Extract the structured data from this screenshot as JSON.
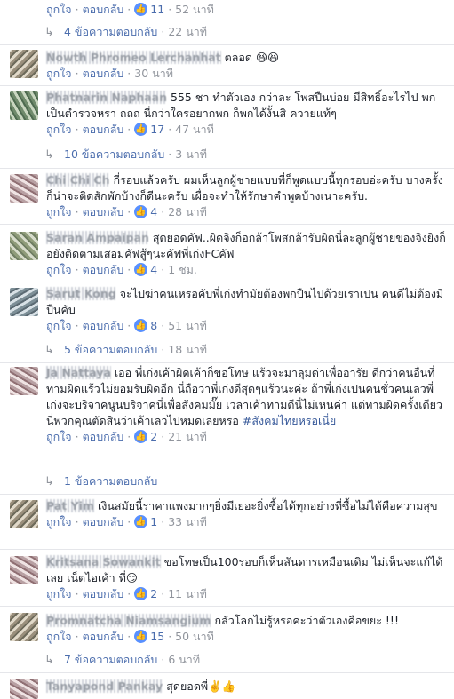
{
  "actions": {
    "like": "ถูกใจ",
    "reply": "ตอบกลับ",
    "sep": "·"
  },
  "comments": [
    {
      "name": "",
      "text": "",
      "likes": "11",
      "time": "52 นาที"
    },
    {
      "name": "Nowth Phromeo Lerchanhat",
      "text": "ตลอด 😆😆",
      "likes": "",
      "time": "30 นาที"
    },
    {
      "name": "Phatnarin Naphaan",
      "text": "555 ชา ทำตัวเอง กว่าละ โพสปืนบ่อย มีสิทธิ์อะไรไป พก เป็นตำรวจหรา ถถถ นี่กว่าใครอยากพก ก็พกได้งั้นสิ ควายแท้ๆ",
      "likes": "17",
      "time": "47 นาที"
    },
    {
      "name": "Chi Chi Ch",
      "text": "กี่รอบแล้วครับ ผมเห็นลูกผู้ชายแบบพี่ก็พูดแบบนี้ทุกรอบอ่ะครับ บางครั้งก็น่าจะติดสักพักบ้างก็ดีนะครับ เผื่อจะทำให้รักษาคำพูดบ้างเนาะครับ.",
      "likes": "4",
      "time": "28 นาที"
    },
    {
      "name": "Saran Ampaipan",
      "text": "สุดยอดคัฟ..ผิดจิงก็อกล้าโพสกล้ารับผิดนี่ละลูกผู้ชายของจิงยิงก็อยังติดตามเสอมคัฟสู้ๆนะคัฟพี่เก่งFCคัฟ",
      "likes": "4",
      "time": "1 ชม."
    },
    {
      "name": "Sarut Kong",
      "text": "จะไปฆ่าคนเหรอคับพี่เก่งทำมัยต้องพกปืนไปด้วยเราเปน คนดีไม่ต้องมีปืนคับ",
      "likes": "8",
      "time": "51 นาที"
    },
    {
      "name": "Ja Nattaya",
      "text": "เออ พี่เก่งเค้าผิดเค้าก็ขอโทษ แร้วจะมาลุมด่าเพื่ออารัย ดีกว่าคนอื่นที่ทามผิดแร้วไม่ยอมรับผิดอีก นี่ถือว่าพี่เก่งดีสุดๆแร้วนะค่ะ ถ้าพี่เก่งเปนคนชั่วคนเลวพี่เก่งจะบริจาคนูนบริจาคนี่เพื่อสังคมมั๊ย เวลาเค้าทามดีนี่ไม่เหนค่า แต่ทามผิดครั้งเดียวนี่พวกคุณตัดสินว่าเค้าเลวไปหมดเลยหรอ ",
      "hashtag": "#สังคมไทยหรอเนี่ย",
      "likes": "2",
      "time": "21 นาที"
    },
    {
      "name": "Pat Yim",
      "text": "เงินสมัยนี้ราคาแพงมากๆยิ่งมีเยอะยิ่งซื้อได้ทุกอย่างที่ซื้อไม่ได้คือความสุข",
      "likes": "1",
      "time": "33 นาที"
    },
    {
      "name": "Kritsana Sowankit",
      "text": "ขอโทษเป็น100รอบก็เห็นสันดารเหมือนเดิม ไม่เห็นจะแก้ได้เลย เน็ตไอเค้า ที่😏",
      "likes": "2",
      "time": "11 นาที"
    },
    {
      "name": "Promnatcha Niamsangium",
      "text": "กลัวโลกไม่รู้หรอคะว่าตัวเองคือขยะ !!!",
      "likes": "15",
      "time": "50 นาที"
    },
    {
      "name": "Tanyapond Pankay",
      "text": "สุดยอดพี่✌️👍",
      "likes": "",
      "time": ""
    }
  ],
  "reply_threads": [
    {
      "label": "4 ข้อความตอบกลับ",
      "time": "22 นาที"
    },
    {
      "label": "10 ข้อความตอบกลับ",
      "time": "3 นาที"
    },
    {
      "label": "5 ข้อความตอบกลับ",
      "time": "18 นาที"
    },
    {
      "label": "1 ข้อความตอบกลับ",
      "time": ""
    },
    {
      "label": "7 ข้อความตอบกลับ",
      "time": "6 นาที"
    }
  ]
}
